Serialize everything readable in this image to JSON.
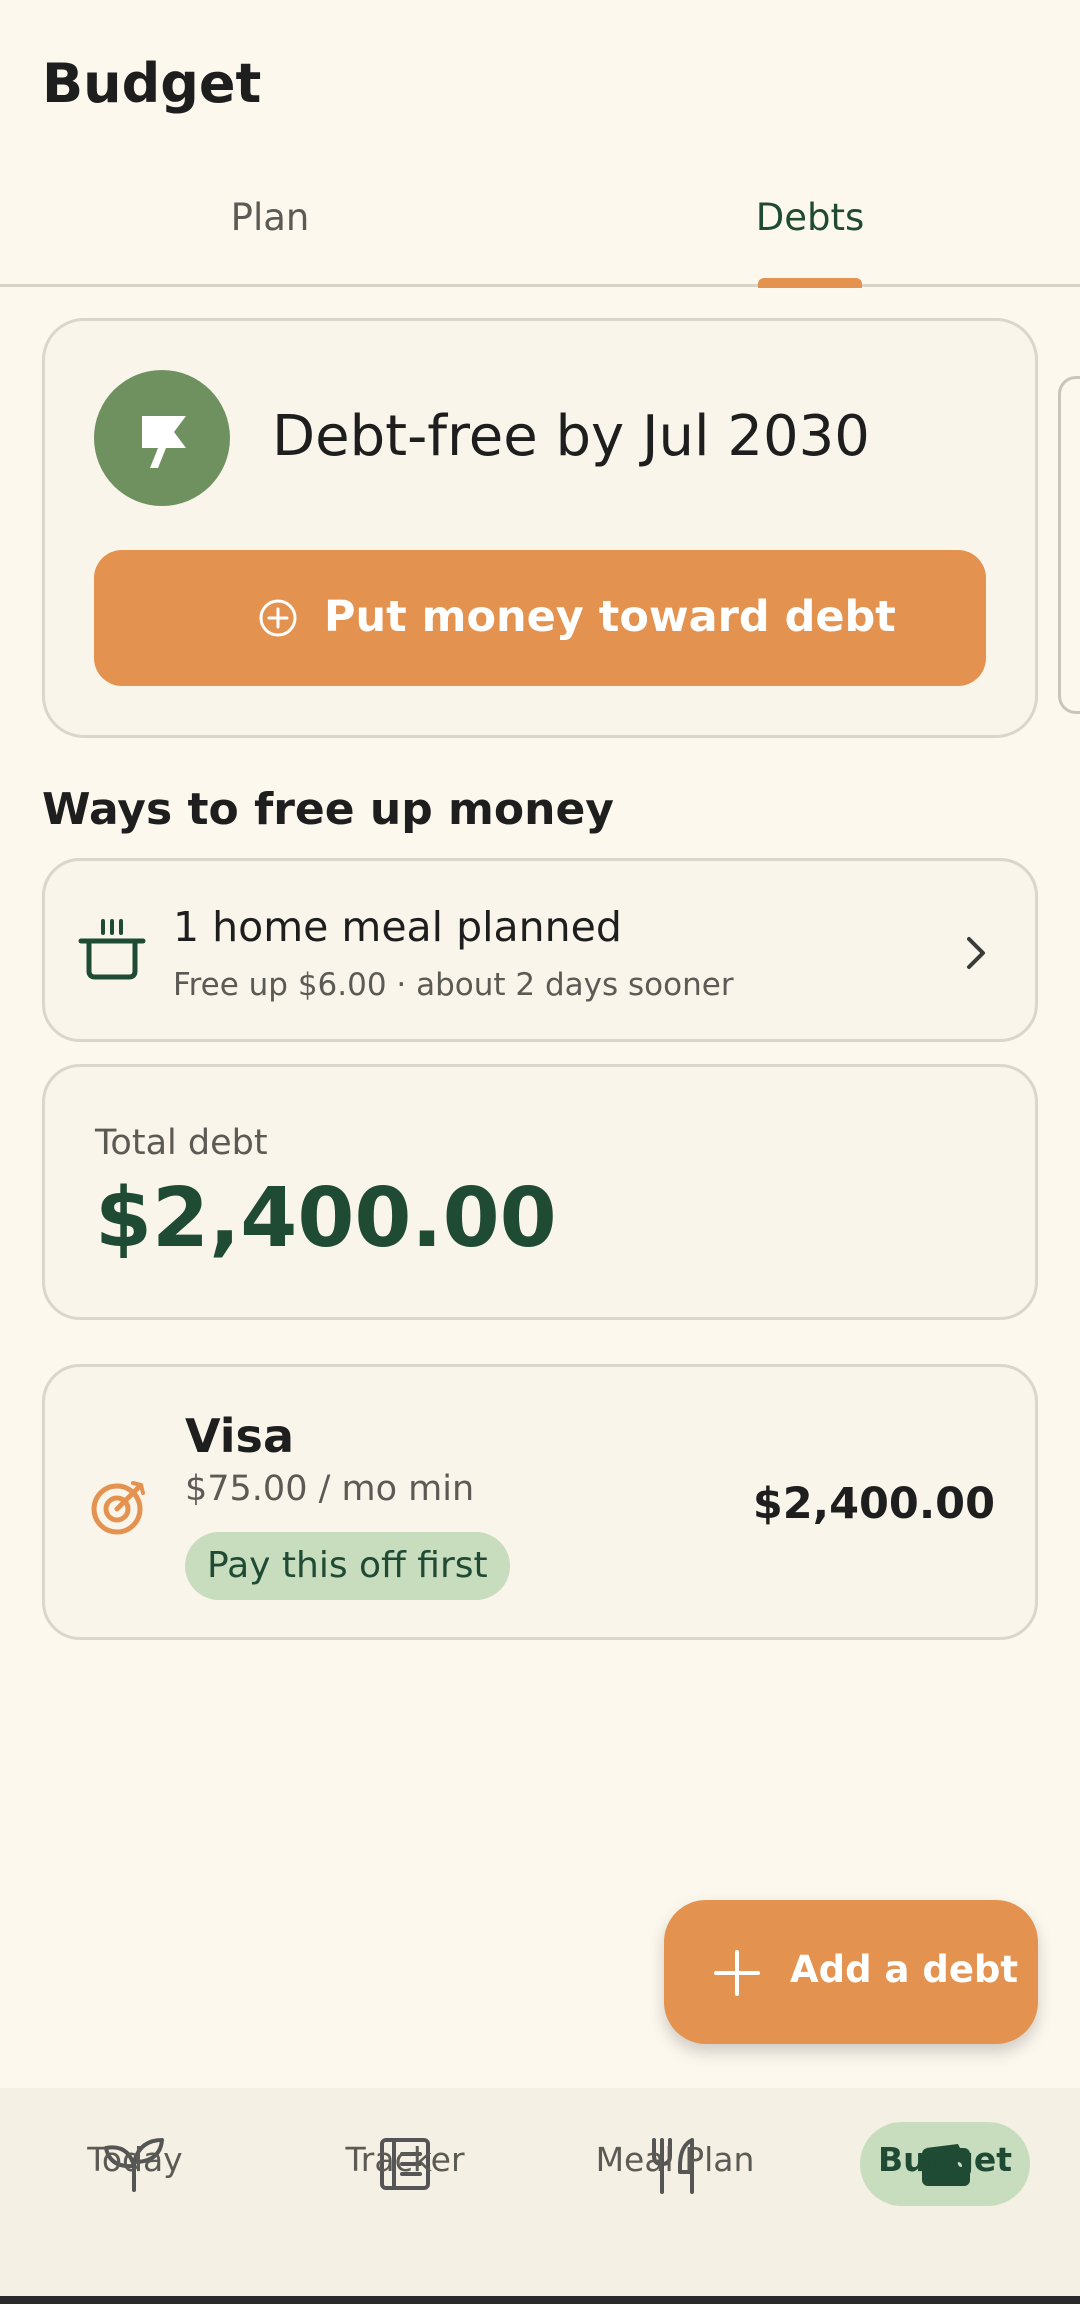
{
  "header": {
    "title": "Budget"
  },
  "tabs": [
    {
      "label": "Plan",
      "active": false
    },
    {
      "label": "Debts",
      "active": true
    }
  ],
  "debt_free": {
    "headline": "Debt-free by Jul 2030",
    "action_label": "Put money toward debt",
    "icon": "flag-icon"
  },
  "ways": {
    "title": "Ways to free up money",
    "item": {
      "title": "1 home meal planned",
      "subtitle": "Free up $6.00 · about 2 days sooner",
      "icon": "pot-icon"
    }
  },
  "total": {
    "label": "Total debt",
    "amount": "$2,400.00"
  },
  "debt_item": {
    "name": "Visa",
    "minimum": "$75.00 / mo min",
    "badge": "Pay this off first",
    "balance": "$2,400.00",
    "icon": "target-icon"
  },
  "fab": {
    "label": "Add a debt"
  },
  "nav": [
    {
      "label": "Today",
      "icon": "sprout-icon",
      "active": false
    },
    {
      "label": "Tracker",
      "icon": "journal-icon",
      "active": false
    },
    {
      "label": "Meal Plan",
      "icon": "utensils-icon",
      "active": false
    },
    {
      "label": "Budget",
      "icon": "wallet-icon",
      "active": true
    }
  ],
  "colors": {
    "accent": "#E4924F",
    "dark_green": "#1F4A33",
    "sage": "#6F9160",
    "pill_green": "#C8DCBE",
    "background": "#FCF8EE"
  }
}
